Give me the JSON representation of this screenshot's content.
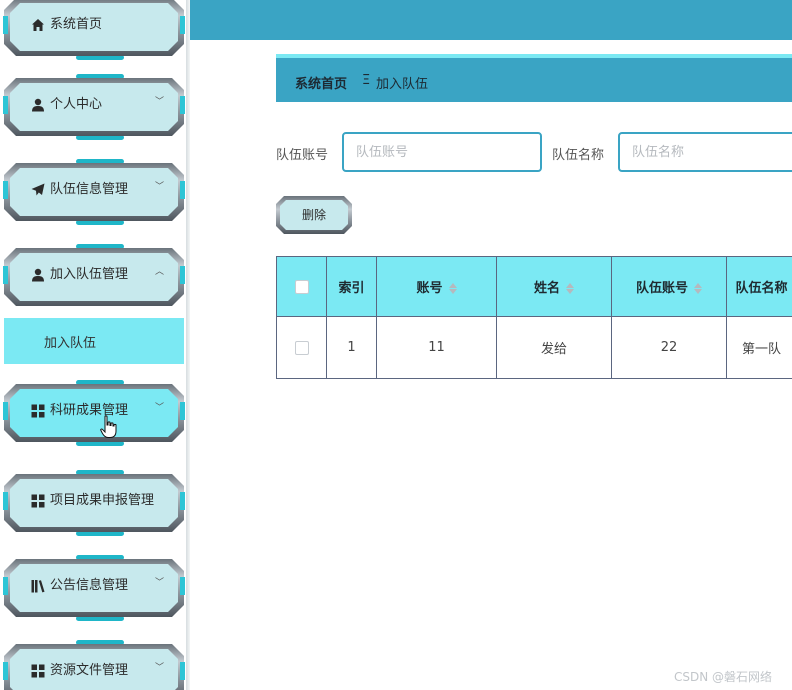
{
  "sidebar": {
    "items": [
      {
        "label": "系统首页",
        "icon": "home-icon",
        "has_chevron": false
      },
      {
        "label": "个人中心",
        "icon": "user-icon",
        "has_chevron": true
      },
      {
        "label": "队伍信息管理",
        "icon": "send-icon",
        "has_chevron": true
      },
      {
        "label": "加入队伍管理",
        "icon": "user-icon",
        "has_chevron": true,
        "expanded": true
      },
      {
        "label": "科研成果管理",
        "icon": "grid-icon",
        "has_chevron": true,
        "hovered": true
      },
      {
        "label": "项目成果申报管理",
        "icon": "grid-icon",
        "has_chevron": false
      },
      {
        "label": "公告信息管理",
        "icon": "library-icon",
        "has_chevron": true
      },
      {
        "label": "资源文件管理",
        "icon": "grid-icon",
        "has_chevron": true
      }
    ],
    "submenu": {
      "label": "加入队伍"
    }
  },
  "breadcrumb": {
    "home": "系统首页",
    "separator": "Ξ",
    "current": "加入队伍"
  },
  "search": {
    "team_account_label": "队伍账号",
    "team_account_placeholder": "队伍账号",
    "team_name_label": "队伍名称",
    "team_name_placeholder": "队伍名称"
  },
  "toolbar": {
    "delete_label": "删除"
  },
  "table": {
    "columns": [
      "索引",
      "账号",
      "姓名",
      "队伍账号",
      "队伍名称"
    ],
    "rows": [
      {
        "index": "1",
        "account": "11",
        "name": "发给",
        "team_account": "22",
        "team_name": "第一队"
      }
    ]
  },
  "watermark": "CSDN @磐石网络",
  "colors": {
    "header": "#3aa4c4",
    "accent": "#7be9f3",
    "menu_plate": "#c7e9ed"
  }
}
